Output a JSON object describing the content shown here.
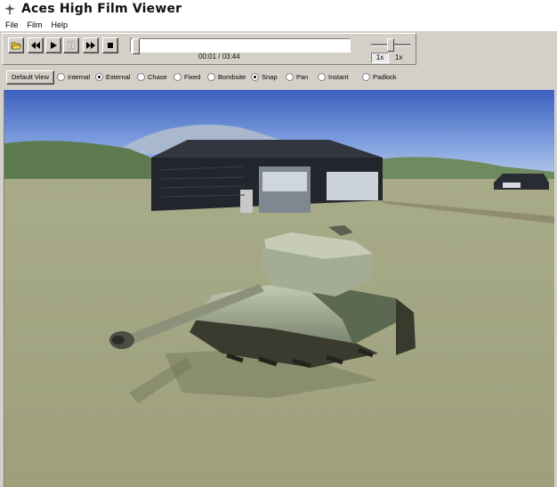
{
  "window": {
    "title": "Aces High Film Viewer"
  },
  "menu": {
    "items": [
      "File",
      "Film",
      "Help"
    ]
  },
  "toolbar": {
    "buttons": [
      "open-folder",
      "rewind",
      "play",
      "pause",
      "fast-forward",
      "stop"
    ],
    "timecode": "00:01 / 03:44",
    "speed_box": "1x",
    "speed_label": "1x",
    "progress_fraction": 0.004
  },
  "views": {
    "default_button": "Default View",
    "options": [
      {
        "label": "Internal",
        "selected": false
      },
      {
        "label": "External",
        "selected": true
      },
      {
        "label": "Chase",
        "selected": false
      },
      {
        "label": "Fixed",
        "selected": false
      },
      {
        "label": "Bombsite",
        "selected": false
      },
      {
        "label": "Snap",
        "selected": true
      },
      {
        "label": "Pan",
        "selected": false
      },
      {
        "label": "Instant",
        "selected": false
      },
      {
        "label": "Padlock",
        "selected": false
      }
    ]
  }
}
